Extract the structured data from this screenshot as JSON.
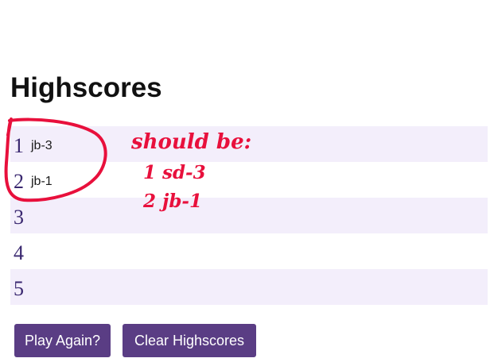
{
  "page": {
    "title": "Highscores"
  },
  "highscores": [
    {
      "rank": "1",
      "name": "jb-3"
    },
    {
      "rank": "2",
      "name": "jb-1"
    },
    {
      "rank": "3",
      "name": ""
    },
    {
      "rank": "4",
      "name": ""
    },
    {
      "rank": "5",
      "name": ""
    }
  ],
  "annotation": {
    "header": "should be:",
    "line1": "1 sd-3",
    "line2": "2 jb-1",
    "color": "#e8103c"
  },
  "buttons": {
    "play_again": "Play Again?",
    "clear_highscores": "Clear Highscores"
  },
  "colors": {
    "accent": "#5a3d84",
    "row_stripe": "#f3eefb",
    "rank_text": "#3a2870"
  }
}
